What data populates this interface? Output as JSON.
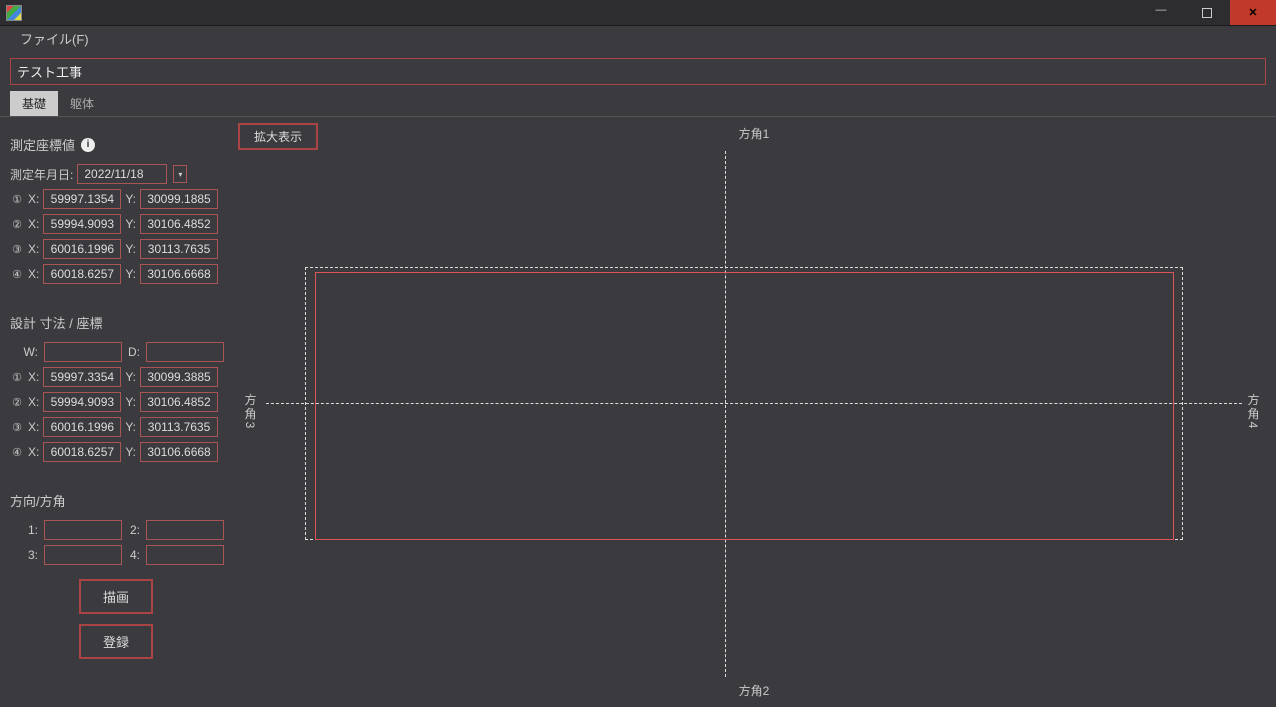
{
  "menu": {
    "file": "ファイル(F)"
  },
  "project_title": "テスト工事",
  "tabs": {
    "foundation": "基礎",
    "body": "躯体"
  },
  "left": {
    "measured_title": "測定座標値",
    "date_label": "測定年月日:",
    "date_value": "2022/11/18",
    "measured": [
      {
        "num": "①",
        "x": "59997.1354",
        "y": "30099.1885"
      },
      {
        "num": "②",
        "x": "59994.9093",
        "y": "30106.4852"
      },
      {
        "num": "③",
        "x": "60016.1996",
        "y": "30113.7635"
      },
      {
        "num": "④",
        "x": "60018.6257",
        "y": "30106.6668"
      }
    ],
    "design_title": "設計 寸法 / 座標",
    "w_label": "W:",
    "d_label": "D:",
    "w_value": "",
    "d_value": "",
    "design": [
      {
        "num": "①",
        "x": "59997.3354",
        "y": "30099.3885"
      },
      {
        "num": "②",
        "x": "59994.9093",
        "y": "30106.4852"
      },
      {
        "num": "③",
        "x": "60016.1996",
        "y": "30113.7635"
      },
      {
        "num": "④",
        "x": "60018.6257",
        "y": "30106.6668"
      }
    ],
    "dir_title": "方向/方角",
    "dir": {
      "l1": "1:",
      "v1": "",
      "l2": "2:",
      "v2": "",
      "l3": "3:",
      "v3": "",
      "l4": "4:",
      "v4": ""
    },
    "btn_draw": "描画",
    "btn_register": "登録",
    "x_label": "X:",
    "y_label": "Y:"
  },
  "right": {
    "zoom_btn": "拡大表示",
    "dir1": "方角1",
    "dir2": "方角2",
    "dir3": "方角3",
    "dir4": "方角4"
  }
}
